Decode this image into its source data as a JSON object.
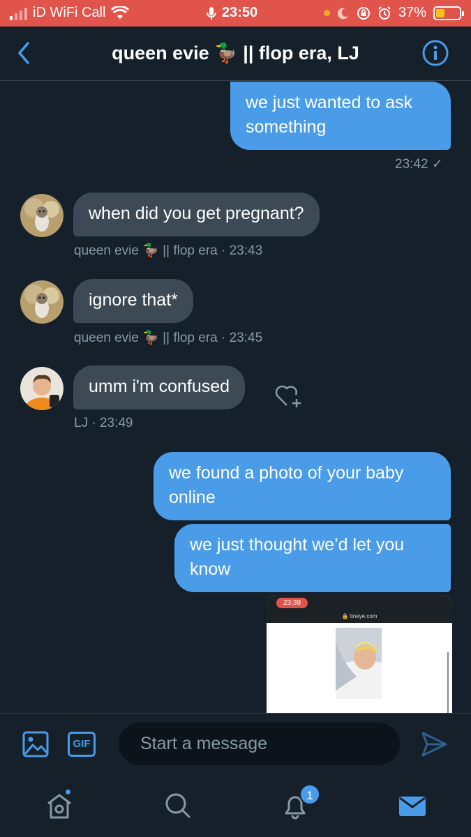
{
  "status_bar": {
    "carrier": "iD WiFi Call",
    "time": "23:50",
    "battery": "37%",
    "battery_level": 0.37,
    "bg_color": "#e0544b"
  },
  "header": {
    "title": "queen evie 🦆 || flop era, LJ",
    "back_icon": "chevron-left-icon",
    "info_icon": "info-icon"
  },
  "messages": [
    {
      "type": "sent",
      "text": "we just wanted to ask something",
      "line1": "we just wanted to ask",
      "line2": "something",
      "meta": "23:42 ✓"
    },
    {
      "type": "received",
      "text": "when did you get pregnant?",
      "meta": "queen evie 🦆 || flop era · 23:43"
    },
    {
      "type": "received",
      "text": "ignore that*",
      "meta": "queen evie 🦆 || flop era · 23:45"
    },
    {
      "type": "received",
      "text": "umm i'm confused",
      "meta": "LJ · 23:49"
    },
    {
      "type": "sent",
      "text": "we found a photo of your baby online",
      "line1": "we found a photo of your baby",
      "line2": "online"
    },
    {
      "type": "sent",
      "text": "we just thought we'd let you know",
      "line1": "we just thought we’d let you",
      "line2": "know"
    }
  ],
  "attachment": {
    "time": "23:39",
    "url": "🔒 tineye.com"
  },
  "composer": {
    "placeholder": "Start a message",
    "gif_label": "GIF"
  },
  "tabbar": {
    "notifications_count": "1",
    "accent": "#4a9be8"
  }
}
